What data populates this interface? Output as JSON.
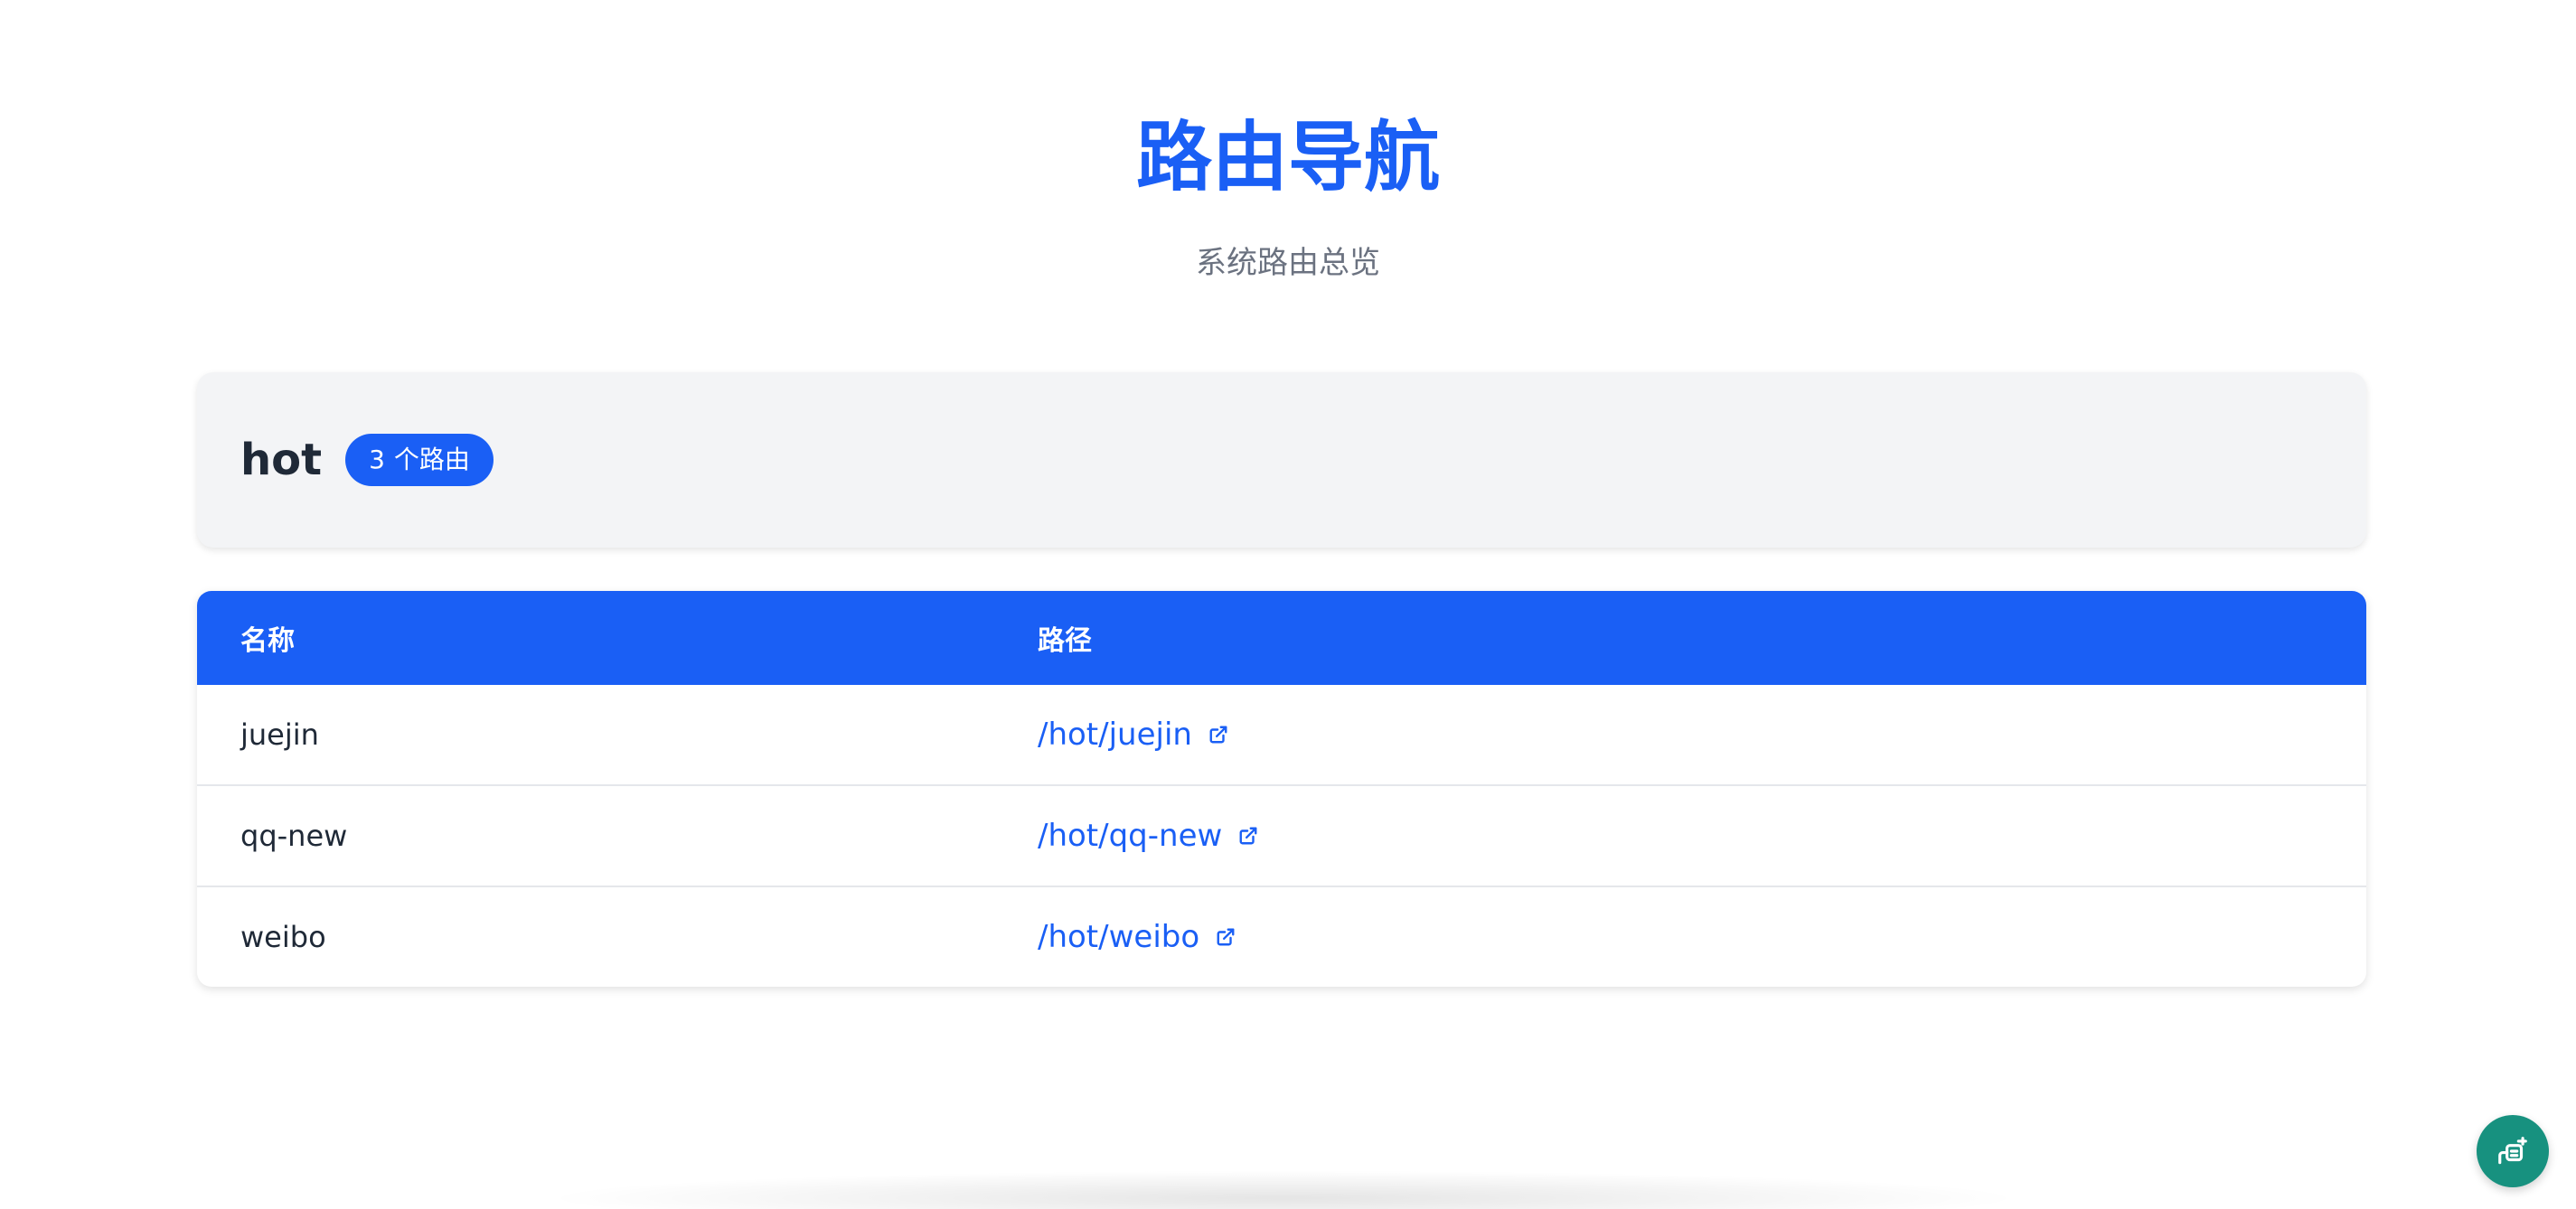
{
  "header": {
    "title": "路由导航",
    "subtitle": "系统路由总览"
  },
  "group": {
    "name": "hot",
    "badge_count": "3",
    "badge_label": "个路由"
  },
  "table": {
    "columns": {
      "name": "名称",
      "path": "路径"
    },
    "rows": [
      {
        "name": "juejin",
        "path": "/hot/juejin"
      },
      {
        "name": "qq-new",
        "path": "/hot/qq-new"
      },
      {
        "name": "weibo",
        "path": "/hot/weibo"
      }
    ],
    "link_icon": "external-link-icon"
  },
  "floating_action": {
    "icon": "plug-icon"
  },
  "colors": {
    "accent": "#1a5ff5",
    "fab": "#17917f",
    "card_bg": "#f3f4f6"
  }
}
